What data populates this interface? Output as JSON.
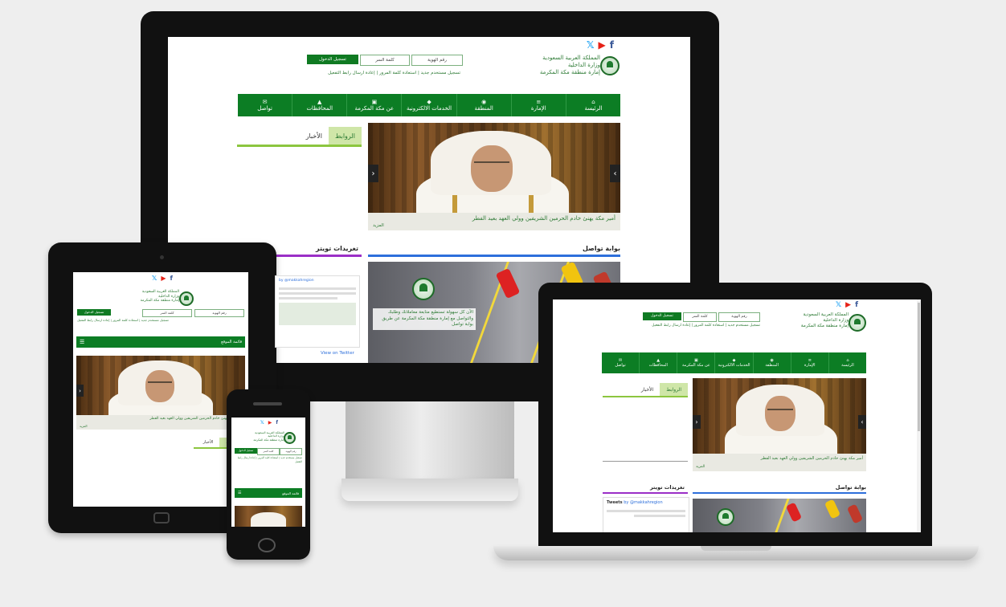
{
  "colors": {
    "brand_green": "#0c7d24",
    "accent_lime": "#8cc63f",
    "twitter_purple": "#9b2fc7",
    "portal_blue": "#2d6fdb",
    "background": "#eeeeee"
  },
  "social": {
    "twitter": "𝕏",
    "youtube": "▶",
    "facebook": "f",
    "twitter_icon": "twitter-icon",
    "youtube_icon": "youtube-icon",
    "facebook_icon": "facebook-icon"
  },
  "brand": {
    "line1": "المملكة العربية السعودية",
    "line2": "وزارة الداخلية",
    "line3": "إمارة منطقة مكة المكرمة"
  },
  "login": {
    "id_placeholder": "رقم الهوية",
    "password_placeholder": "كلمة السر",
    "login_button": "تسجيل الدخول",
    "links": "تسجيل مستخدم جديد | استعادة كلمة المرور | إعادة ارسال رابط التفعيل"
  },
  "nav": {
    "items": [
      "الرئيسة",
      "الإمارة",
      "المنطقة",
      "الخدمات الالكترونية",
      "عن مكة المكرمة",
      "المحافظات",
      "تواصل"
    ],
    "icons": [
      "⌂",
      "≡",
      "◉",
      "◆",
      "▣",
      "▲",
      "✉"
    ]
  },
  "mobile_menu": {
    "label": "قائمة الموقع",
    "icon": "menu-icon"
  },
  "tabs": {
    "active": "الروابط",
    "inactive": "الأخبار"
  },
  "slider": {
    "caption": "أمير مكة يهنئ خادم الحرمين الشريفين وولي العهد بعيد الفطر",
    "more": "المزيد"
  },
  "portal": {
    "title": "بوابة تواصل",
    "promo": "الآن كل سهولة تستطيع متابعة معاملاتك وطلبك والتواصل مع إمارة منطقة مكة المكرمة عن طريق بوابة تواصل"
  },
  "twitter": {
    "title": "تغريدات تويتر",
    "header": "Tweets",
    "handle": "by @makkahregion",
    "view_on_twitter": "View on Twitter"
  }
}
